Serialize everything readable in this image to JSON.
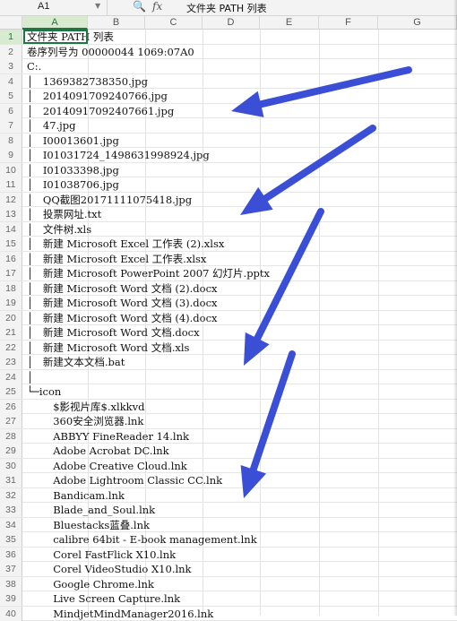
{
  "formula_bar": {
    "cell_ref": "A1",
    "value": "文件夹 PATH 列表"
  },
  "columns": [
    "A",
    "B",
    "C",
    "D",
    "E",
    "F",
    "G"
  ],
  "rows": [
    {
      "num": "1",
      "text": "文件夹 PATH 列表"
    },
    {
      "num": "2",
      "text": "卷序列号为 00000044 1069:07A0"
    },
    {
      "num": "3",
      "text": "C:."
    },
    {
      "num": "4",
      "text": "│   1369382738350.jpg"
    },
    {
      "num": "5",
      "text": "│   2014091709240766.jpg"
    },
    {
      "num": "6",
      "text": "│   20140917092407661.jpg"
    },
    {
      "num": "7",
      "text": "│   47.jpg"
    },
    {
      "num": "8",
      "text": "│   I00013601.jpg"
    },
    {
      "num": "9",
      "text": "│   I01031724_1498631998924.jpg"
    },
    {
      "num": "10",
      "text": "│   I01033398.jpg"
    },
    {
      "num": "11",
      "text": "│   I01038706.jpg"
    },
    {
      "num": "12",
      "text": "│   QQ截图20171111075418.jpg"
    },
    {
      "num": "13",
      "text": "│   投票网址.txt"
    },
    {
      "num": "14",
      "text": "│   文件树.xls"
    },
    {
      "num": "15",
      "text": "│   新建 Microsoft Excel 工作表 (2).xlsx"
    },
    {
      "num": "16",
      "text": "│   新建 Microsoft Excel 工作表.xlsx"
    },
    {
      "num": "17",
      "text": "│   新建 Microsoft PowerPoint 2007 幻灯片.pptx"
    },
    {
      "num": "18",
      "text": "│   新建 Microsoft Word 文档 (2).docx"
    },
    {
      "num": "19",
      "text": "│   新建 Microsoft Word 文档 (3).docx"
    },
    {
      "num": "20",
      "text": "│   新建 Microsoft Word 文档 (4).docx"
    },
    {
      "num": "21",
      "text": "│   新建 Microsoft Word 文档.docx"
    },
    {
      "num": "22",
      "text": "│   新建 Microsoft Word 文档.xls"
    },
    {
      "num": "23",
      "text": "│   新建文本文档.bat"
    },
    {
      "num": "24",
      "text": "│"
    },
    {
      "num": "25",
      "text": "└─icon"
    },
    {
      "num": "26",
      "text": "        $影视片库$.xlkkvd"
    },
    {
      "num": "27",
      "text": "        360安全浏览器.lnk"
    },
    {
      "num": "28",
      "text": "        ABBYY FineReader 14.lnk"
    },
    {
      "num": "29",
      "text": "        Adobe Acrobat DC.lnk"
    },
    {
      "num": "30",
      "text": "        Adobe Creative Cloud.lnk"
    },
    {
      "num": "31",
      "text": "        Adobe Lightroom Classic CC.lnk"
    },
    {
      "num": "32",
      "text": "        Bandicam.lnk"
    },
    {
      "num": "33",
      "text": "        Blade_and_Soul.lnk"
    },
    {
      "num": "34",
      "text": "        Bluestacks蓝叠.lnk"
    },
    {
      "num": "35",
      "text": "        calibre 64bit - E-book management.lnk"
    },
    {
      "num": "36",
      "text": "        Corel FastFlick X10.lnk"
    },
    {
      "num": "37",
      "text": "        Corel VideoStudio X10.lnk"
    },
    {
      "num": "38",
      "text": "        Google Chrome.lnk"
    },
    {
      "num": "39",
      "text": "        Live Screen Capture.lnk"
    },
    {
      "num": "40",
      "text": "        MindjetMindManager2016.lnk"
    }
  ],
  "colors": {
    "accent": "#217346",
    "arrow": "#3b4fd6"
  }
}
